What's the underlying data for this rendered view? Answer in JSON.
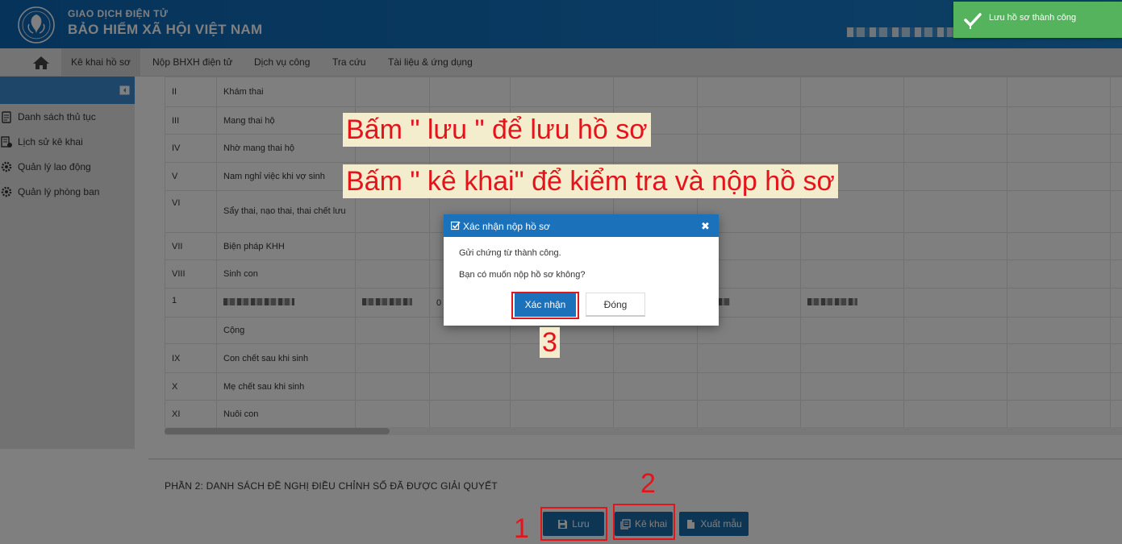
{
  "header": {
    "brand_line1": "GIAO DỊCH ĐIỆN TỬ",
    "brand_line2": "BẢO HIỂM XÃ HỘI VIỆT NAM"
  },
  "toast": {
    "message": "Lưu hồ sơ thành công"
  },
  "nav": {
    "items": [
      "Kê khai hồ sơ",
      "Nộp BHXH điện tử",
      "Dịch vụ công",
      "Tra cứu",
      "Tài liệu & ứng dụng"
    ],
    "active_index": 0
  },
  "sidebar": {
    "items": [
      "Danh sách thủ tục",
      "Lịch sử kê khai",
      "Quản lý lao động",
      "Quản lý phòng ban"
    ]
  },
  "table": {
    "rows": [
      {
        "code": "II",
        "label": "Khám thai"
      },
      {
        "code": "III",
        "label": "Mang thai hộ"
      },
      {
        "code": "IV",
        "label": "Nhờ mang thai hộ"
      },
      {
        "code": "V",
        "label": "Nam nghỉ việc khi vợ sinh"
      },
      {
        "code": "VI",
        "label": "Sẩy thai, nạo thai, thai chết lưu"
      },
      {
        "code": "VII",
        "label": "Biện pháp KHH"
      },
      {
        "code": "VIII",
        "label": "Sinh con"
      },
      {
        "code": "1",
        "label": ""
      },
      {
        "code": "",
        "label": "Cộng"
      },
      {
        "code": "IX",
        "label": "Con chết sau khi sinh"
      },
      {
        "code": "X",
        "label": "Mẹ chết sau khi sinh"
      },
      {
        "code": "XI",
        "label": "Nuôi con"
      }
    ],
    "row1_partial": "0"
  },
  "section2_title": "PHẦN 2: DANH SÁCH ĐỀ NGHỊ ĐIỀU CHỈNH SỐ ĐÃ ĐƯỢC GIẢI QUYẾT",
  "buttons": {
    "save": "Lưu",
    "declare": "Kê khai",
    "export": "Xuất mẫu"
  },
  "annotations": {
    "line1": "Bấm \" lưu \" để lưu hồ sơ",
    "line2": "Bấm \" kê khai\"  để kiểm tra và nộp hồ sơ",
    "step1": "1",
    "step2": "2",
    "step3": "3"
  },
  "modal": {
    "title": "Xác nhận nộp hồ sơ",
    "close_symbol": "✖",
    "message1": "Gửi chứng từ thành công.",
    "message2": "Bạn có muốn nộp hồ sơ không?",
    "confirm": "Xác nhận",
    "close": "Đóng"
  },
  "colors": {
    "header_blue": "#1576c4",
    "toast_green": "#54b35c",
    "button_blue": "#1b6aa8",
    "annotation_red": "#e5141b"
  }
}
